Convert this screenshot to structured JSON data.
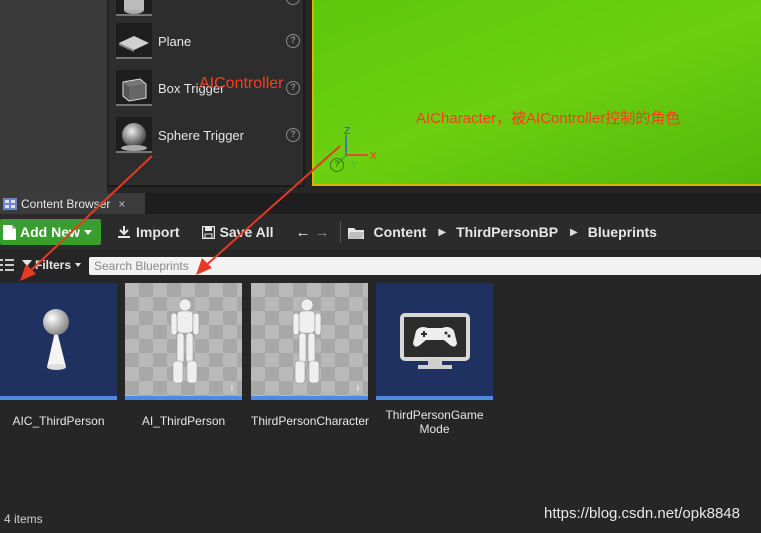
{
  "place_panel": {
    "items": [
      {
        "label": "Plane",
        "icon": "plane-icon"
      },
      {
        "label": "Box Trigger",
        "icon": "box-trigger-icon"
      },
      {
        "label": "Sphere Trigger",
        "icon": "sphere-trigger-icon"
      }
    ],
    "help_glyph": "?"
  },
  "viewport": {
    "gizmo": {
      "z": "Z",
      "x": "X",
      "y": "Y"
    },
    "annotation_character": "AICharacter，被AIController控制的角色",
    "annotation_controller": "AIController"
  },
  "tab": {
    "label": "Content Browser",
    "close": "×"
  },
  "toolbar": {
    "add_new": "Add New",
    "import": "Import",
    "save_all": "Save All",
    "breadcrumbs": [
      "Content",
      "ThirdPersonBP",
      "Blueprints"
    ]
  },
  "filters": {
    "label": "Filters",
    "search_placeholder": "Search Blueprints"
  },
  "assets": [
    {
      "name": "AIC_ThirdPerson"
    },
    {
      "name": "AI_ThirdPerson"
    },
    {
      "name": "ThirdPersonCharacter"
    },
    {
      "name": "ThirdPersonGame Mode"
    }
  ],
  "status": {
    "item_count": "4 items"
  },
  "watermark": "https://blog.csdn.net/opk8848",
  "colors": {
    "annotation": "#ff3b1f",
    "viewport": "#66cc0e",
    "add_new": "#3a9d2f",
    "selection_bar": "#4d8ae6"
  }
}
